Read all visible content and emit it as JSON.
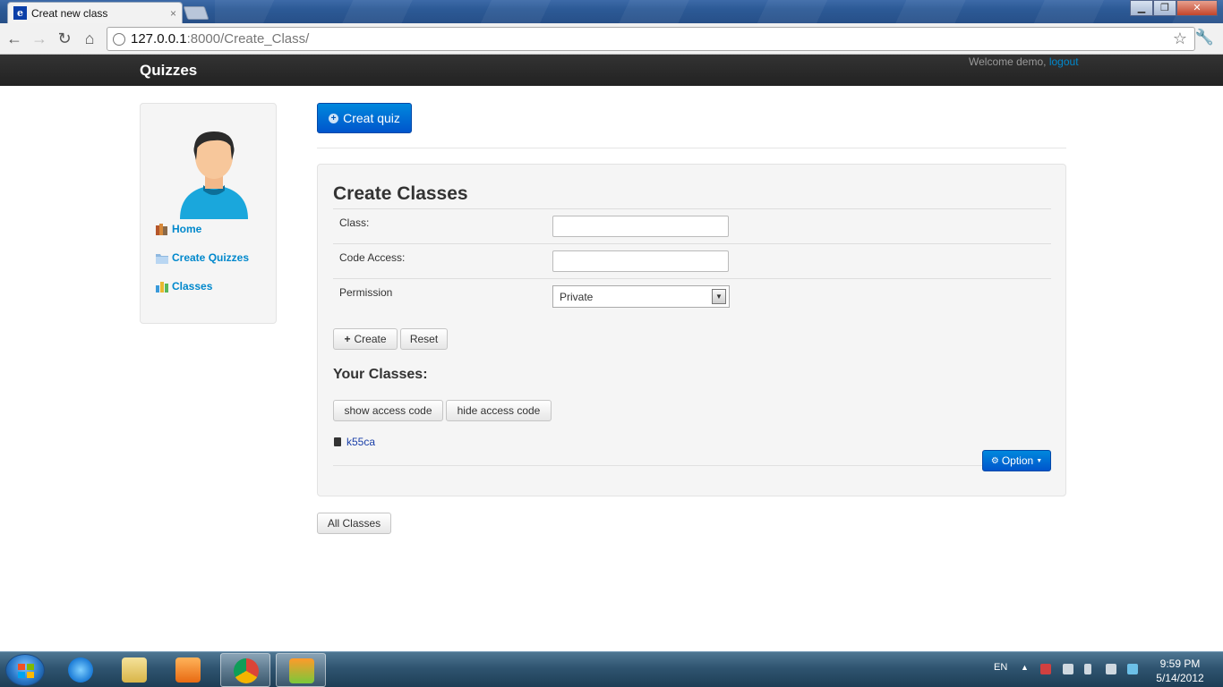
{
  "browser": {
    "tab_title": "Creat new class",
    "tab_favicon": "e",
    "close_glyph": "×",
    "url_host": "127.0.0.1",
    "url_rest": ":8000/Create_Class/",
    "back_glyph": "←",
    "forward_glyph": "→",
    "reload_glyph": "↻",
    "home_glyph": "⌂",
    "star_glyph": "☆",
    "wrench_glyph": "🔧",
    "window_controls": {
      "minimize": "▁",
      "maximize": "❐",
      "close": "✕"
    }
  },
  "navbar": {
    "brand": "Quizzes",
    "welcome": "Welcome demo,",
    "logout": "logout"
  },
  "sidebar": {
    "items": [
      {
        "label": "Home",
        "icon": "books-icon"
      },
      {
        "label": "Create Quizzes",
        "icon": "folder-icon"
      },
      {
        "label": "Classes",
        "icon": "bar-chart-icon"
      }
    ]
  },
  "actions": {
    "creat_quiz": "Creat quiz"
  },
  "form": {
    "title": "Create Classes",
    "class_label": "Class:",
    "class_value": "",
    "code_label": "Code Access:",
    "code_value": "",
    "permission_label": "Permission",
    "permission_value": "Private",
    "create_label": "Create",
    "reset_label": "Reset"
  },
  "classes": {
    "heading": "Your Classes:",
    "show_label": "show access code",
    "hide_label": "hide access code",
    "items": [
      "k55ca"
    ],
    "option_label": "Option",
    "all_label": "All Classes"
  },
  "taskbar": {
    "lang": "EN",
    "time": "9:59 PM",
    "date": "5/14/2012"
  },
  "colors": {
    "link": "#0088cc",
    "primary": "#0066cc",
    "navbar": "#222222"
  }
}
